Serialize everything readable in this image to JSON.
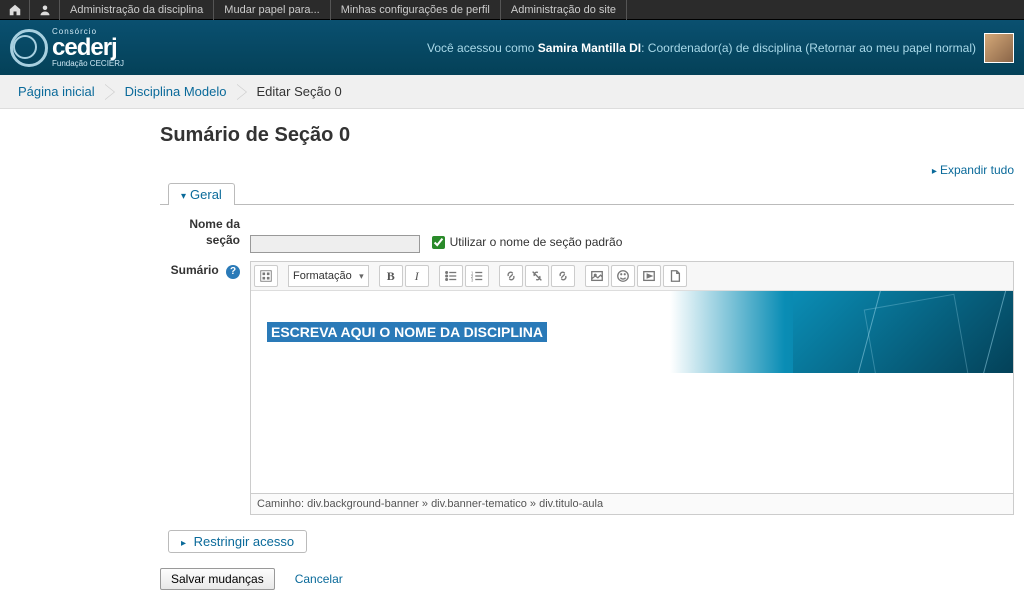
{
  "topbar": {
    "items": [
      "Administração da disciplina",
      "Mudar papel para...",
      "Minhas configurações de perfil",
      "Administração do site"
    ]
  },
  "header": {
    "logo_consorcio": "Consórcio",
    "logo_main": "cederj",
    "logo_sub": "Fundação CECIERJ",
    "login_prefix": "Você acessou como ",
    "username": "Samira Mantilla DI",
    "role": ": Coordenador(a) de disciplina ",
    "return_link": "Retornar ao meu papel normal"
  },
  "breadcrumb": {
    "items": [
      {
        "label": "Página inicial",
        "link": true
      },
      {
        "label": "Disciplina Modelo",
        "link": true
      },
      {
        "label": "Editar Seção 0",
        "link": false
      }
    ]
  },
  "page": {
    "title": "Sumário de Seção 0",
    "expand_all": "Expandir tudo"
  },
  "fieldset_general": {
    "legend": "Geral",
    "name_label": "Nome da seção",
    "use_default_name": "Utilizar o nome de seção padrão",
    "summary_label": "Sumário"
  },
  "editor": {
    "format_label": "Formatação",
    "banner_title": "ESCREVA AQUI O NOME DA DISCIPLINA",
    "path_label": "Caminho: div.background-banner » div.banner-tematico » div.titulo-aula"
  },
  "fieldset_restrict": {
    "legend": "Restringir acesso"
  },
  "actions": {
    "save": "Salvar mudanças",
    "cancel": "Cancelar"
  }
}
